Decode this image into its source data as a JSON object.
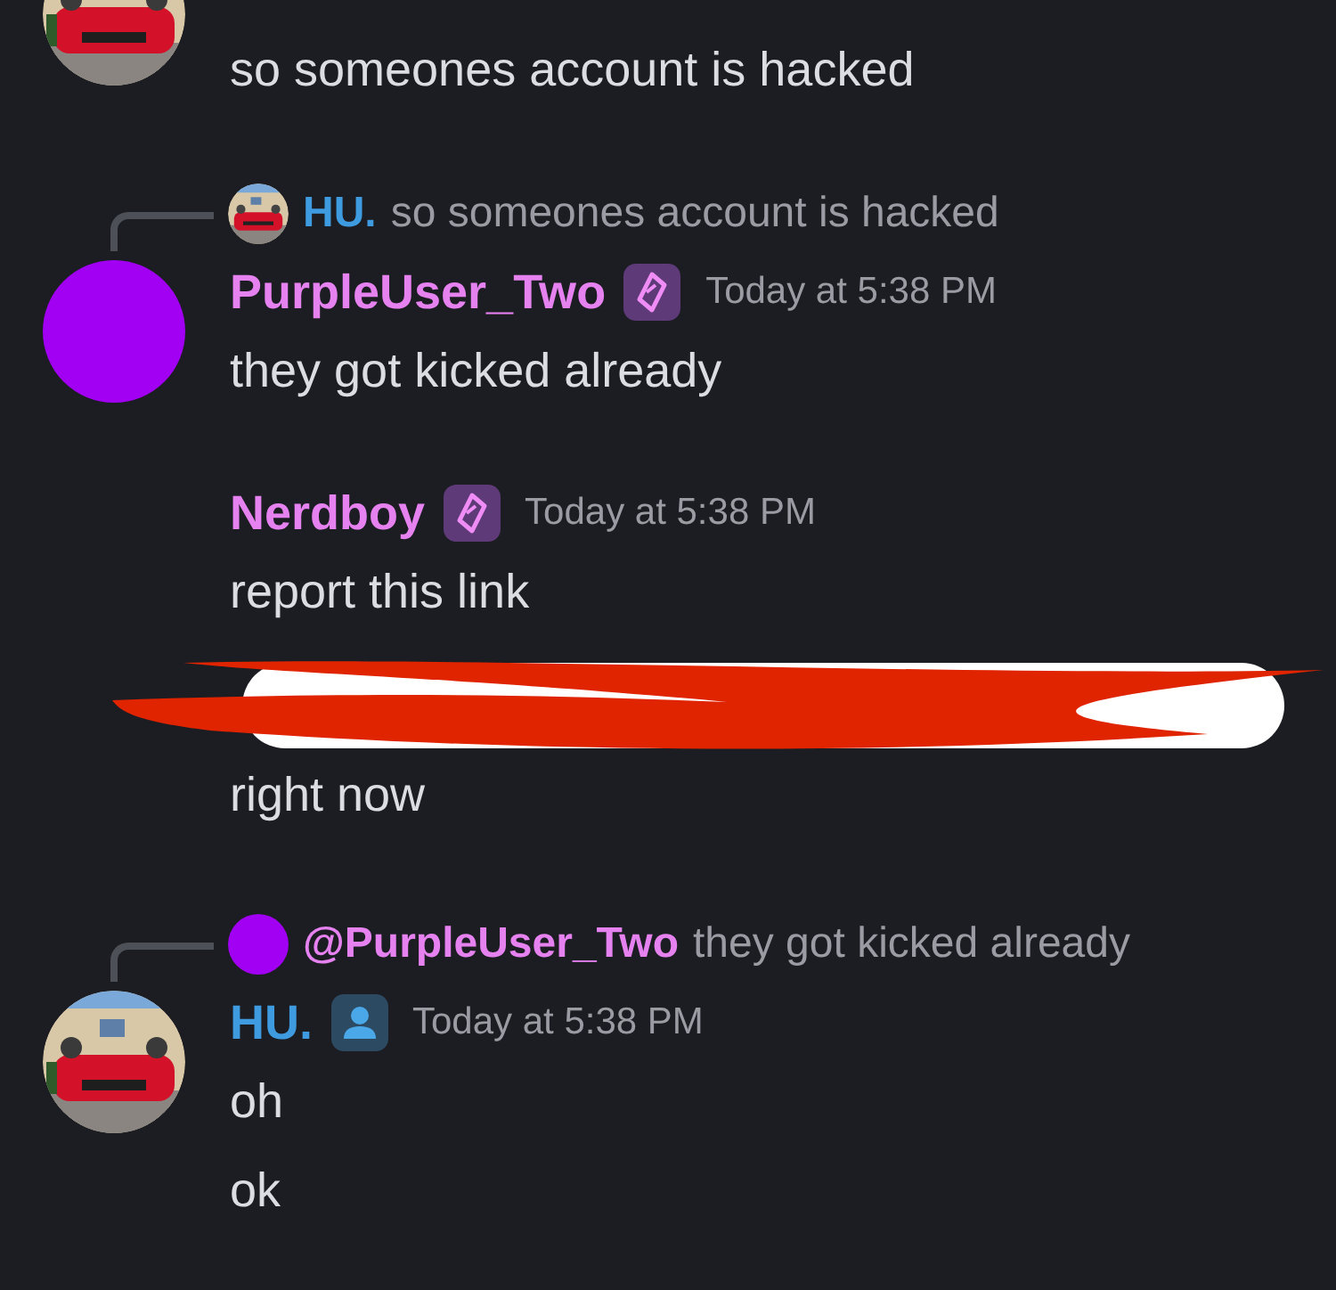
{
  "groups": [
    {
      "avatar": {
        "kind": "picture"
      },
      "lines": [
        {
          "kind": "text",
          "text": "so someones account is hacked"
        }
      ]
    },
    {
      "avatar": {
        "kind": "plain",
        "color": "#a100f2"
      },
      "reply": {
        "avatar": {
          "kind": "picture"
        },
        "name": "HU.",
        "color": "#3e9be0",
        "text": "so someones account is hacked"
      },
      "header": {
        "name": "PurpleUser_Two",
        "color": "#e681f0",
        "badge": {
          "kind": "crystal"
        },
        "time": "Today at 5:38 PM"
      },
      "lines": [
        {
          "kind": "text",
          "text": "they got kicked already"
        }
      ]
    },
    {
      "header": {
        "name": "Nerdboy",
        "color": "#e681f0",
        "badge": {
          "kind": "crystal"
        },
        "time": "Today at 5:38 PM"
      },
      "lines": [
        {
          "kind": "text",
          "text": "report this link"
        },
        {
          "kind": "redacted_link"
        },
        {
          "kind": "text",
          "text": "right now"
        }
      ]
    },
    {
      "avatar": {
        "kind": "picture"
      },
      "reply": {
        "avatar": {
          "kind": "plain",
          "color": "#a100f2"
        },
        "name": "@PurpleUser_Two",
        "color": "#e681f0",
        "text": "they got kicked already"
      },
      "header": {
        "name": "HU.",
        "color": "#3e9be0",
        "badge": {
          "kind": "person"
        },
        "time": "Today at 5:38 PM"
      },
      "lines": [
        {
          "kind": "text",
          "text": "oh"
        },
        {
          "kind": "text",
          "text": "ok"
        }
      ]
    }
  ]
}
